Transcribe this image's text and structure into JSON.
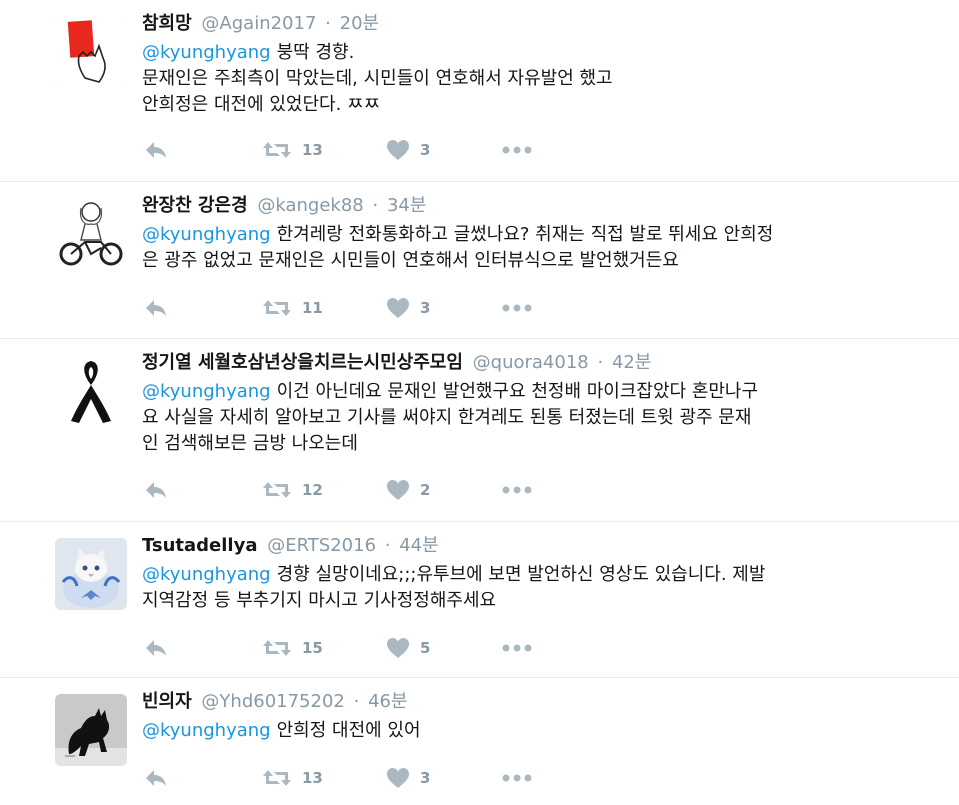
{
  "colors": {
    "link": "#1b95e0",
    "meta": "#8899a6",
    "icon": "#aab8c2",
    "divider": "#e6ecf0"
  },
  "tweets": [
    {
      "name": "참희망",
      "handle": "@Again2017",
      "time": "20분",
      "mention": "@kyunghyang",
      "text": "붕딱 경향.\n문재인은 주최측이 막았는데, 시민들이 연호해서 자유발언 했고\n안희정은 대전에 있었단다. ㅉㅉ",
      "retweets": "13",
      "likes": "3",
      "avatar_icon": "red-card-icon"
    },
    {
      "name": "완장찬 강은경",
      "handle": "@kangek88",
      "time": "34분",
      "mention": "@kyunghyang",
      "text": "한겨레랑 전화통화하고 글썼나요? 취재는 직접 발로 뛰세요 안희정\n은 광주 없었고 문재인은 시민들이 연호해서 인터뷰식으로 발언했거든요",
      "retweets": "11",
      "likes": "3",
      "avatar_icon": "motorbike-sketch-icon"
    },
    {
      "name": "정기열 세월호삼년상을치르는시민상주모임",
      "handle": "@quora4018",
      "time": "42분",
      "mention": "@kyunghyang",
      "text": "이건 아닌데요 문재인 발언했구요 천정배 마이크잡았다 혼만나구\n요 사실을 자세히 알아보고 기사를 써야지 한겨레도 된통 터졌는데  트윗 광주 문재\n인 검색해보믄 금방 나오는데",
      "retweets": "12",
      "likes": "2",
      "avatar_icon": "black-ribbon-icon"
    },
    {
      "name": "Tsutadellya",
      "handle": "@ERTS2016",
      "time": "44분",
      "mention": "@kyunghyang",
      "text": "경향 실망이네요;;;유투브에 보면 발언하신 영상도 있습니다. 제발\n지역감정 등 부추기지 마시고 기사정정해주세요",
      "retweets": "15",
      "likes": "5",
      "avatar_icon": "white-cat-icon"
    },
    {
      "name": "빈의자",
      "handle": "@Yhd60175202",
      "time": "46분",
      "mention": "@kyunghyang",
      "text": "안희정 대전에 있어",
      "retweets": "13",
      "likes": "3",
      "avatar_icon": "black-cat-icon"
    }
  ]
}
